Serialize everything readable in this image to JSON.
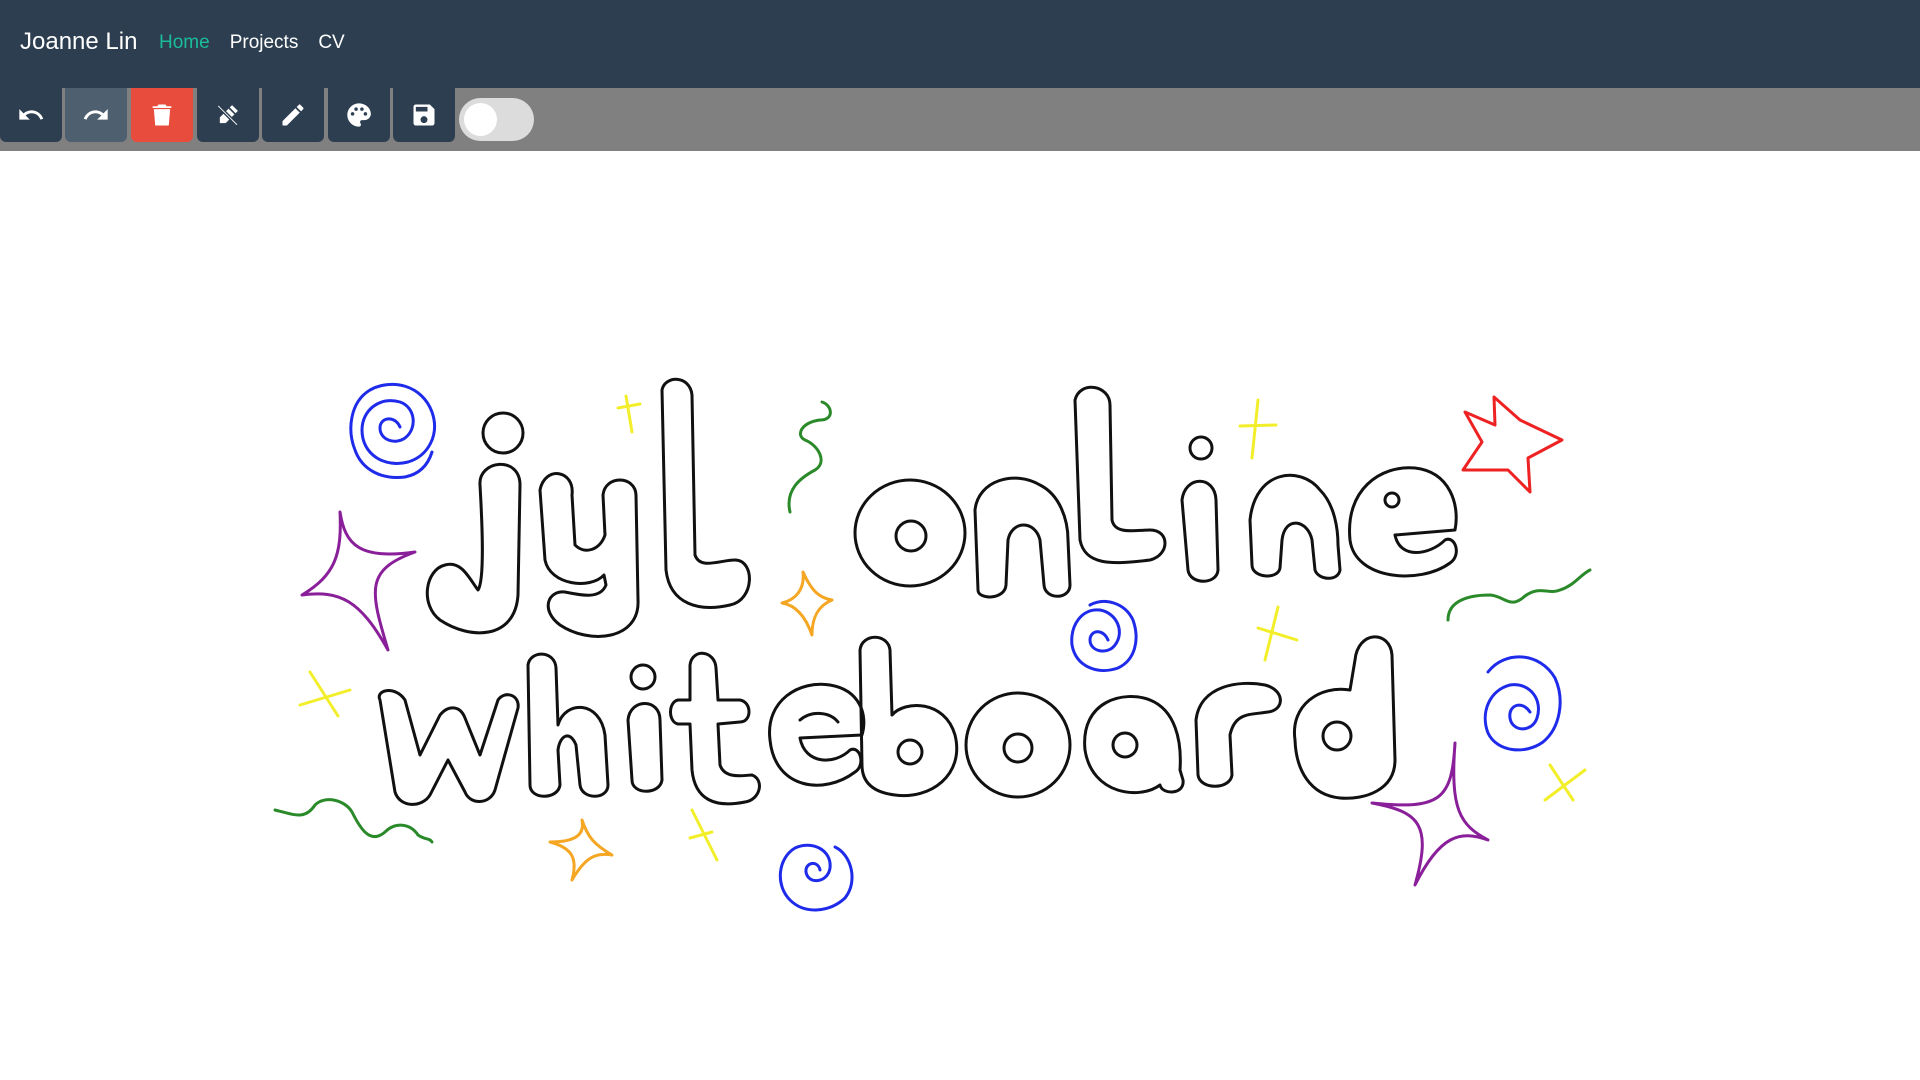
{
  "navbar": {
    "brand": "Joanne Lin",
    "links": [
      {
        "label": "Home",
        "active": true
      },
      {
        "label": "Projects",
        "active": false
      },
      {
        "label": "CV",
        "active": false
      }
    ],
    "background": "#2c3e50",
    "active_color": "#1abc9c"
  },
  "toolbar": {
    "buttons": [
      {
        "name": "undo-button",
        "icon": "undo-icon",
        "state": "enabled"
      },
      {
        "name": "redo-button",
        "icon": "redo-icon",
        "state": "disabled"
      },
      {
        "name": "clear-button",
        "icon": "trash-icon",
        "state": "danger"
      },
      {
        "name": "eraser-button",
        "icon": "pen-slash-icon",
        "state": "enabled"
      },
      {
        "name": "pen-button",
        "icon": "pencil-icon",
        "state": "enabled"
      },
      {
        "name": "color-button",
        "icon": "palette-icon",
        "state": "enabled"
      },
      {
        "name": "save-button",
        "icon": "save-icon",
        "state": "enabled"
      }
    ],
    "toggle": {
      "on": false
    },
    "background": "#808080",
    "danger_color": "#e74c3c"
  },
  "canvas": {
    "drawn_text": [
      "jyl online",
      "whiteboard"
    ],
    "ink_colors": {
      "black": "#111111",
      "blue": "#1f2bea",
      "purple": "#8a1f9a",
      "green": "#2a8a2a",
      "yellow": "#f2ee2a",
      "orange": "#f5a623",
      "red": "#ee2222"
    }
  }
}
